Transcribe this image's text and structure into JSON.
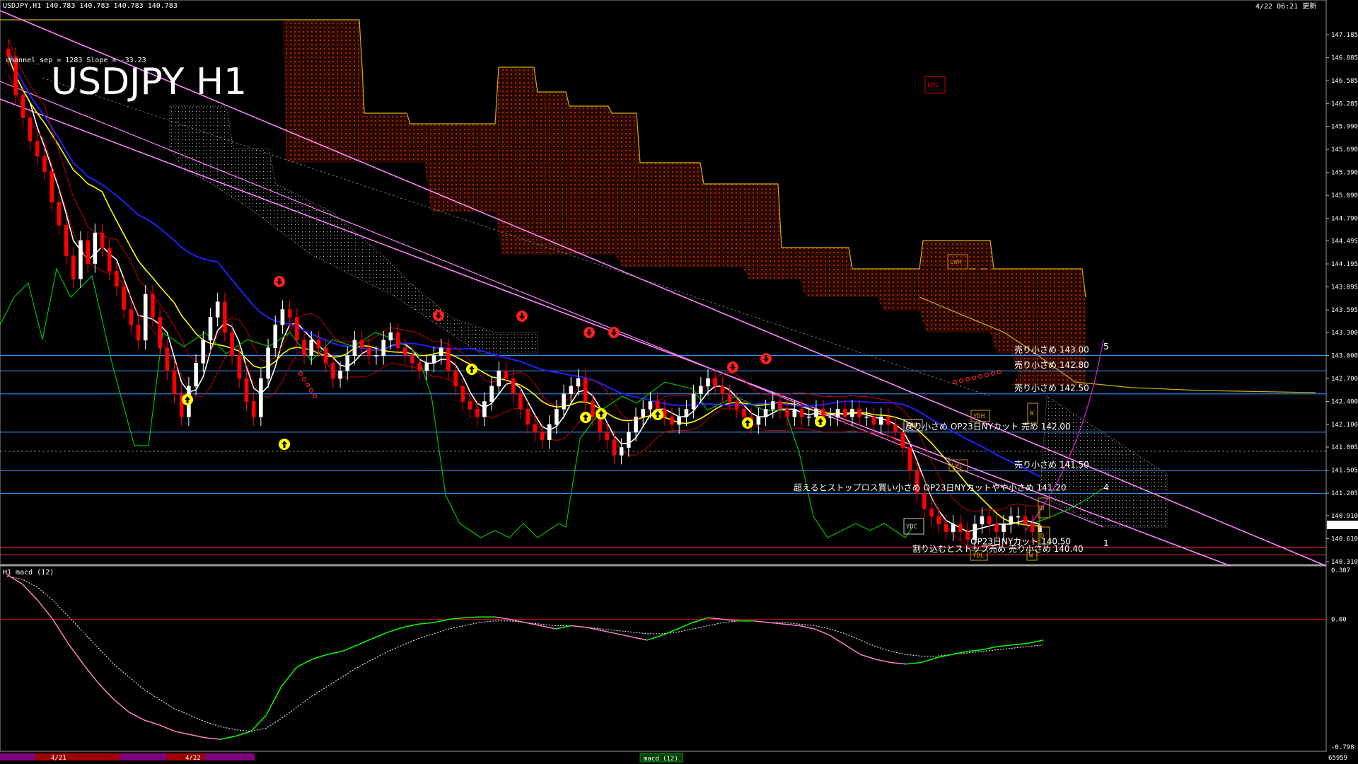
{
  "header": {
    "symbol_info": "USDJPY,H1  140.783 140.783 140.783 140.783",
    "channel_info": "channel_sep = 1283  Slope = -33.23",
    "timestamp": "4/22 06:21 更新"
  },
  "main_title": "USDJPY H1",
  "macd_label": "H1  macd (12)",
  "footer": {
    "dates": [
      "4/21",
      "4/22"
    ],
    "center_tab": "macd (12)",
    "right_value": "65959"
  },
  "level_labels": [
    {
      "price": 143.0,
      "text": "売り小さめ 143.00"
    },
    {
      "price": 142.8,
      "text": "売り小さめ 142.80"
    },
    {
      "price": 142.5,
      "text": "売り小さめ 142.50"
    },
    {
      "price": 142.0,
      "text": "戻り小さめ  OP23日NYカット  売め 142.00"
    },
    {
      "price": 141.5,
      "text": "売り小さめ 141.50"
    },
    {
      "price": 141.2,
      "text": "超えるとストップロス買い小さめ  OP23日NYカットやや小さめ 141.20"
    },
    {
      "price": 140.5,
      "text": "OP23日NYカット 140.50"
    },
    {
      "price": 140.4,
      "text": "割り込むとストップ売め  売り小さめ 140.40"
    }
  ],
  "boxes": [
    {
      "text": "LML",
      "color": "#d00000"
    },
    {
      "text": "LWH",
      "color": "#d08000"
    },
    {
      "text": "YDH",
      "color": "#d0a000"
    },
    {
      "text": "W",
      "color": "#d0a000"
    },
    {
      "text": "YDO",
      "color": "#cccccc"
    },
    {
      "text": "LWL",
      "color": "#d08000"
    },
    {
      "text": "YDC",
      "color": "#cccccc"
    },
    {
      "text": "YDC",
      "color": "#cccccc"
    },
    {
      "text": "D",
      "color": "#d0a000"
    },
    {
      "text": "D",
      "color": "#d0a000"
    },
    {
      "text": "YDL",
      "color": "#d0a000"
    },
    {
      "text": "W",
      "color": "#d0a000"
    }
  ],
  "wave_labels": [
    "5",
    "4",
    "1"
  ],
  "current_price": "140.783",
  "colors": {
    "bull": "#ffffff",
    "bear": "#ff0000",
    "kumo": "#ff4000",
    "kumo_edge": "#d0b000",
    "channel": "#ff80ff",
    "ma_fast": "#ffffff",
    "ma_mid": "#ffff00",
    "ma_slow": "#2020ff",
    "chikou": "#00c000",
    "level_line": "#3399ff",
    "macd": "#00ff00",
    "macd_neg": "#ff80c0",
    "signal": "#ffffff"
  },
  "chart_data": [
    {
      "type": "candlestick",
      "title": "USDJPY H1",
      "ylim": [
        140.31,
        147.38
      ],
      "yticks": [
        "147.185",
        "146.885",
        "146.585",
        "146.285",
        "145.990",
        "145.690",
        "145.390",
        "145.090",
        "144.790",
        "144.495",
        "144.195",
        "143.895",
        "143.595",
        "143.300",
        "143.000",
        "142.700",
        "142.400",
        "142.100",
        "141.805",
        "141.505",
        "141.205",
        "140.910",
        "140.610",
        "140.310"
      ],
      "closes": [
        146.9,
        146.4,
        146.1,
        145.8,
        145.6,
        145.4,
        145.0,
        144.7,
        144.3,
        144.0,
        144.5,
        144.2,
        144.6,
        144.4,
        144.1,
        143.9,
        143.6,
        143.4,
        143.2,
        143.8,
        143.5,
        143.1,
        142.8,
        142.5,
        142.2,
        142.6,
        142.9,
        143.2,
        143.5,
        143.7,
        143.3,
        143.0,
        142.7,
        142.4,
        142.2,
        142.7,
        143.1,
        143.4,
        143.6,
        143.5,
        143.2,
        143.0,
        143.2,
        143.1,
        142.9,
        142.7,
        142.8,
        143.0,
        143.2,
        143.1,
        143.0,
        143.0,
        143.2,
        143.3,
        143.1,
        143.0,
        142.9,
        142.8,
        142.9,
        143.0,
        143.1,
        142.8,
        142.6,
        142.4,
        142.3,
        142.2,
        142.4,
        142.6,
        142.8,
        142.7,
        142.5,
        142.3,
        142.1,
        142.0,
        141.9,
        142.1,
        142.3,
        142.5,
        142.6,
        142.7,
        142.4,
        142.2,
        142.0,
        141.9,
        141.7,
        141.8,
        142.0,
        142.2,
        142.3,
        142.4,
        142.3,
        142.2,
        142.1,
        142.2,
        142.3,
        142.5,
        142.6,
        142.7,
        142.6,
        142.5,
        142.4,
        142.3,
        142.2,
        142.1,
        142.2,
        142.3,
        142.4,
        142.3,
        142.2,
        142.3,
        142.2,
        142.2,
        142.3,
        142.2,
        142.2,
        142.3,
        142.2,
        142.3,
        142.2,
        142.2,
        142.1,
        142.2,
        142.1,
        142.0,
        141.8,
        141.5,
        141.2,
        141.0,
        140.9,
        140.8,
        140.7,
        140.8,
        140.7,
        140.6,
        140.8,
        140.9,
        140.8,
        140.7,
        140.8,
        140.9,
        140.9,
        140.8,
        140.7,
        140.78
      ],
      "axis_ranges": {
        "macd": [
          -0.798,
          0.307
        ]
      },
      "levels": [
        143.0,
        142.8,
        142.5,
        142.0,
        141.5,
        141.2,
        140.5,
        140.4
      ]
    },
    {
      "type": "line",
      "title": "macd (12)",
      "ylim": [
        -0.798,
        0.307
      ],
      "yticks": [
        "0.307",
        "0.00",
        "-0.798"
      ],
      "series": [
        {
          "values": [
            0.28,
            0.22,
            0.12,
            0.0,
            -0.15,
            -0.28,
            -0.4,
            -0.5,
            -0.58,
            -0.63,
            -0.66,
            -0.7,
            -0.72,
            -0.74,
            -0.75,
            -0.73,
            -0.7,
            -0.6,
            -0.42,
            -0.3,
            -0.25,
            -0.22,
            -0.2,
            -0.16,
            -0.12,
            -0.08,
            -0.05,
            -0.03,
            -0.02,
            0.0,
            0.01,
            0.015,
            0.015,
            0.0,
            -0.02,
            -0.04,
            -0.06,
            -0.04,
            -0.05,
            -0.07,
            -0.09,
            -0.11,
            -0.13,
            -0.1,
            -0.06,
            -0.02,
            0.01,
            0.0,
            -0.01,
            -0.01,
            -0.02,
            -0.03,
            -0.04,
            -0.06,
            -0.1,
            -0.16,
            -0.22,
            -0.25,
            -0.27,
            -0.28,
            -0.27,
            -0.24,
            -0.22,
            -0.2,
            -0.19,
            -0.17,
            -0.16,
            -0.15,
            -0.13
          ]
        },
        {
          "values": [
            0.27,
            0.25,
            0.2,
            0.12,
            0.02,
            -0.08,
            -0.18,
            -0.28,
            -0.36,
            -0.44,
            -0.5,
            -0.56,
            -0.6,
            -0.64,
            -0.67,
            -0.69,
            -0.7,
            -0.68,
            -0.62,
            -0.55,
            -0.48,
            -0.42,
            -0.36,
            -0.3,
            -0.25,
            -0.2,
            -0.16,
            -0.12,
            -0.09,
            -0.06,
            -0.04,
            -0.02,
            -0.01,
            -0.01,
            -0.02,
            -0.03,
            -0.04,
            -0.04,
            -0.05,
            -0.06,
            -0.07,
            -0.08,
            -0.09,
            -0.09,
            -0.08,
            -0.06,
            -0.04,
            -0.02,
            -0.01,
            -0.01,
            -0.02,
            -0.02,
            -0.03,
            -0.04,
            -0.06,
            -0.09,
            -0.13,
            -0.17,
            -0.2,
            -0.22,
            -0.23,
            -0.23,
            -0.22,
            -0.21,
            -0.2,
            -0.19,
            -0.18,
            -0.17,
            -0.16
          ]
        }
      ]
    }
  ]
}
